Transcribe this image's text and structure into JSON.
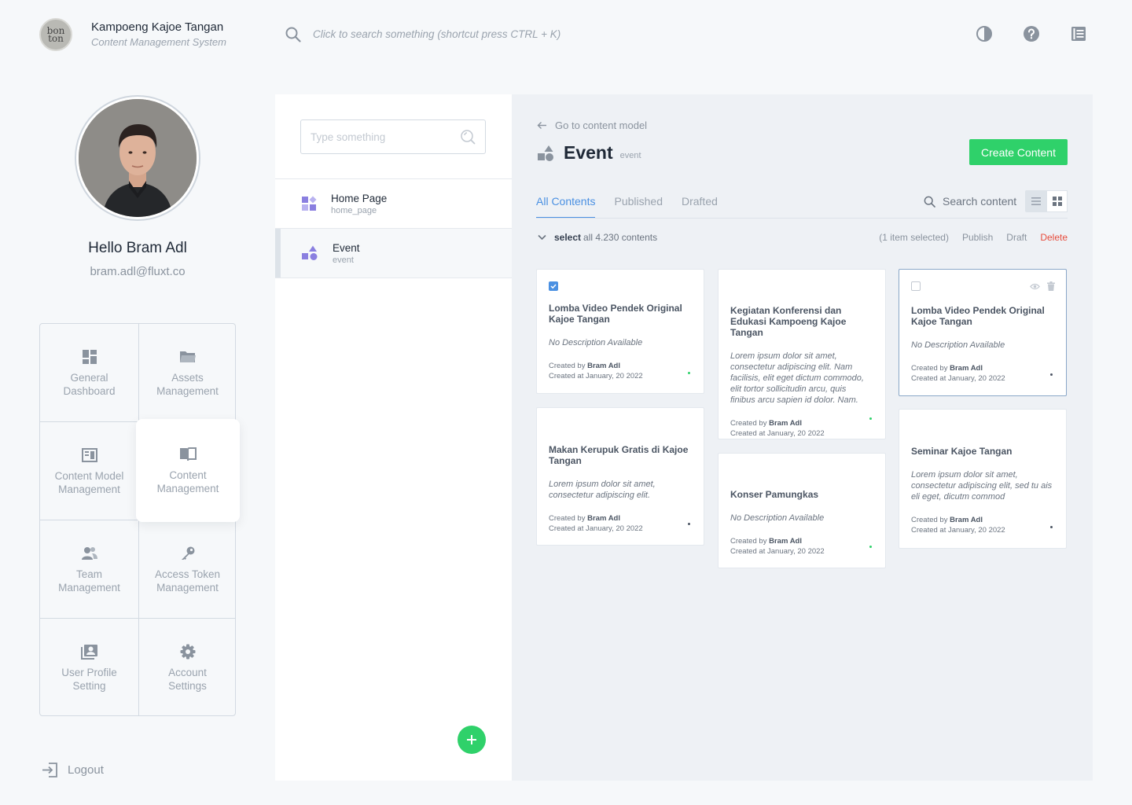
{
  "header": {
    "logo_text": "bon ton",
    "title": "Kampoeng Kajoe Tangan",
    "subtitle": "Content Management System",
    "search_placeholder": "Click to search something (shortcut press CTRL + K)",
    "icons": [
      "contrast-icon",
      "help-icon",
      "docs-icon"
    ]
  },
  "profile": {
    "greeting": "Hello Bram Adl",
    "email": "bram.adl@fluxt.co"
  },
  "menu": {
    "items": [
      {
        "label": "General\nDashboard",
        "icon": "dashboard-icon"
      },
      {
        "label": "Assets\nManagement",
        "icon": "folder-icon"
      },
      {
        "label": "Content Model\nManagement",
        "icon": "content-model-icon"
      },
      {
        "label": "Content\nManagement",
        "icon": "book-icon",
        "active": true
      },
      {
        "label": "Team\nManagement",
        "icon": "team-icon"
      },
      {
        "label": "Access Token\nManagement",
        "icon": "key-icon"
      },
      {
        "label": "User Profile\nSetting",
        "icon": "user-profile-icon"
      },
      {
        "label": "Account\nSettings",
        "icon": "gear-icon"
      }
    ],
    "logout_label": "Logout"
  },
  "models": {
    "search_placeholder": "Type something",
    "items": [
      {
        "name": "Home Page",
        "key": "home_page"
      },
      {
        "name": "Event",
        "key": "event",
        "selected": true
      }
    ]
  },
  "content": {
    "back_label": "Go to content model",
    "model_title": "Event",
    "model_key": "event",
    "create_label": "Create Content",
    "tabs": [
      "All Contents",
      "Published",
      "Drafted"
    ],
    "search_label": "Search content",
    "select_bold": "select",
    "select_rest": "all 4.230 contents",
    "selected_info": "(1 item selected)",
    "publish_label": "Publish",
    "draft_label": "Draft",
    "delete_label": "Delete",
    "colors": {
      "accent": "#4a90e2",
      "success": "#2fd16a",
      "danger": "#e74c3c"
    },
    "cards": [
      {
        "title": "Lomba Video Pendek Original Kajoe Tangan",
        "desc": "No Description Available",
        "created_by_label": "Created by",
        "author": "Bram Adl",
        "created_at": "Created at January, 20 2022",
        "checked": true
      },
      {
        "title": "Makan Kerupuk Gratis di Kajoe Tangan",
        "desc": "Lorem ipsum dolor sit amet, consectetur adipiscing elit.",
        "created_by_label": "Created by",
        "author": "Bram Adl",
        "created_at": "Created at January, 20 2022"
      },
      {
        "title": "Kegiatan Konferensi dan Edukasi Kampoeng Kajoe Tangan",
        "desc": "Lorem ipsum dolor sit amet, consectetur adipiscing elit. Nam facilisis, elit eget dictum commodo, elit tortor sollicitudin arcu, quis finibus arcu sapien id dolor. Nam.",
        "created_by_label": "Created by",
        "author": "Bram Adl",
        "created_at": "Created at January, 20 2022"
      },
      {
        "title": "Konser Pamungkas",
        "desc": "No Description Available",
        "created_by_label": "Created by",
        "author": "Bram Adl",
        "created_at": "Created at January, 20 2022"
      },
      {
        "title": "Lomba Video Pendek Original Kajoe Tangan",
        "desc": "No Description Available",
        "created_by_label": "Created by",
        "author": "Bram Adl",
        "created_at": "Created at January, 20 2022",
        "hovered": true
      },
      {
        "title": "Seminar Kajoe Tangan",
        "desc": "Lorem ipsum dolor sit amet, consectetur adipiscing elit, sed tu ais eli eget, dicutm commod",
        "created_by_label": "Created by",
        "author": "Bram Adl",
        "created_at": "Created at January, 20 2022"
      }
    ]
  }
}
